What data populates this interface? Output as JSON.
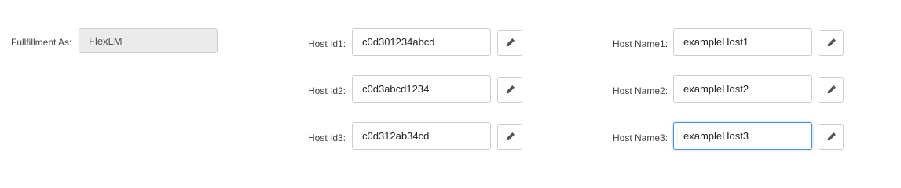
{
  "fulfillment": {
    "label": "Fullfillment As:",
    "value": "FlexLM"
  },
  "host_ids": [
    {
      "label": "Host Id1:",
      "value": "c0d301234abcd"
    },
    {
      "label": "Host Id2:",
      "value": "c0d3abcd1234"
    },
    {
      "label": "Host Id3:",
      "value": "c0d312ab34cd"
    }
  ],
  "host_names": [
    {
      "label": "Host Name1:",
      "value": "exampleHost1"
    },
    {
      "label": "Host Name2:",
      "value": "exampleHost2"
    },
    {
      "label": "Host Name3:",
      "value": "exampleHost3"
    }
  ],
  "icons": {
    "edit": "pencil-icon"
  },
  "colors": {
    "focus_border": "#4a90d9",
    "readonly_bg": "#ebebeb"
  }
}
